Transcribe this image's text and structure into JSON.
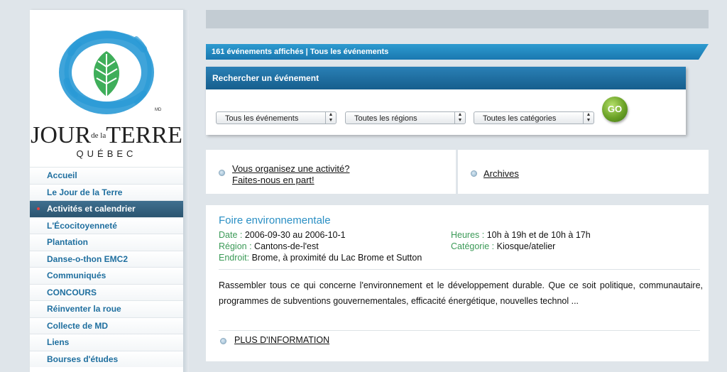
{
  "logo": {
    "jour": "JOUR",
    "de_la": "de la",
    "terre": "TERRE",
    "quebec": "QUÉBEC",
    "reg_mark": "MD"
  },
  "nav": {
    "items": [
      {
        "label": "Accueil"
      },
      {
        "label": "Le Jour de la Terre"
      },
      {
        "label": "Activités et calendrier",
        "active": true
      },
      {
        "label": "L'Écocitoyenneté"
      },
      {
        "label": "Plantation"
      },
      {
        "label": "Danse-o-thon EMC2"
      },
      {
        "label": "Communiqués"
      },
      {
        "label": "CONCOURS"
      },
      {
        "label": "Réinventer la roue"
      },
      {
        "label": "Collecte de MD"
      },
      {
        "label": "Liens"
      },
      {
        "label": "Bourses d'études"
      }
    ]
  },
  "count_bar": {
    "text": "161 événements affichés | Tous les événements"
  },
  "search": {
    "title": "Rechercher un événement",
    "select_events": "Tous les événements",
    "select_regions": "Toutes les régions",
    "select_categories": "Toutes les catégories",
    "go_label": "GO"
  },
  "info_links": {
    "organize_line1": "Vous organisez une activité?",
    "organize_line2": "Faites-nous en part!",
    "archives": "Archives"
  },
  "event": {
    "title": "Foire environnementale",
    "date_label": "Date :",
    "date_value": "2006-09-30 au 2006-10-1",
    "region_label": "Région :",
    "region_value": "Cantons-de-l'est",
    "place_label": "Endroit:",
    "place_value": "Brome, à proximité du Lac Brome et Sutton",
    "hours_label": "Heures :",
    "hours_value": "10h à 19h et de 10h à 17h",
    "category_label": "Catégorie :",
    "category_value": "Kiosque/atelier",
    "description": "Rassembler tous ce qui concerne l'environnement et le développement durable. Que ce soit politique, communautaire, programmes de subventions gouvernementales, efficacité énergétique, nouvelles technol ...",
    "more_label": "PLUS D'INFORMATION"
  },
  "colors": {
    "accent_blue": "#1f6f9f",
    "header_blue": "#1a78b0",
    "label_green": "#3b9a57",
    "go_green": "#6aa126"
  }
}
